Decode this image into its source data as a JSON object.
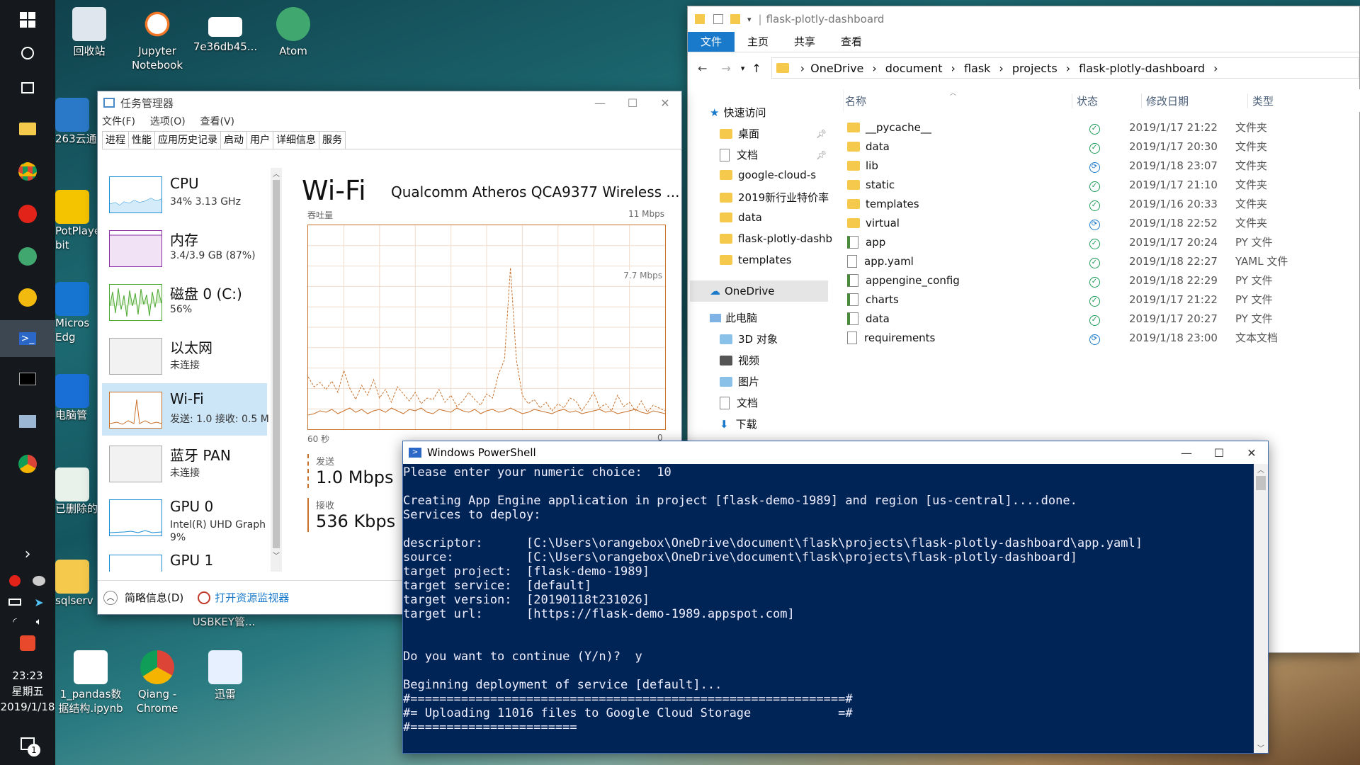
{
  "taskbar": {
    "time": "23:23",
    "weekday": "星期五",
    "date": "2019/1/18",
    "notification_count": "1"
  },
  "desktop": {
    "icons": [
      {
        "label": "回收站"
      },
      {
        "label": "Jupyter\nNotebook"
      },
      {
        "label": "7e36db45..."
      },
      {
        "label": "Atom"
      },
      {
        "label": "263云通"
      },
      {
        "label": "PotPlayer bit"
      },
      {
        "label": "Micros Edg"
      },
      {
        "label": "电脑管"
      },
      {
        "label": "已删除的"
      },
      {
        "label": "sqlserv"
      },
      {
        "label": "USBKEY管..."
      },
      {
        "label": "1_pandas数据结构.ipynb"
      },
      {
        "label": "Qiang - Chrome"
      },
      {
        "label": "迅雷"
      }
    ]
  },
  "task_manager": {
    "title": "任务管理器",
    "menu": [
      "文件(F)",
      "选项(O)",
      "查看(V)"
    ],
    "tabs": [
      "进程",
      "性能",
      "应用历史记录",
      "启动",
      "用户",
      "详细信息",
      "服务"
    ],
    "selected_tab": "性能",
    "sidebar": [
      {
        "name": "CPU",
        "sub": "34% 3.13 GHz"
      },
      {
        "name": "内存",
        "sub": "3.4/3.9 GB (87%)"
      },
      {
        "name": "磁盘 0 (C:)",
        "sub": "56%"
      },
      {
        "name": "以太网",
        "sub": "未连接"
      },
      {
        "name": "Wi-Fi",
        "sub": "发送: 1.0 接收: 0.5 M"
      },
      {
        "name": "蓝牙 PAN",
        "sub": "未连接"
      },
      {
        "name": "GPU 0",
        "sub": "Intel(R) UHD Graph",
        "sub2": "9%"
      },
      {
        "name": "GPU 1",
        "sub": ""
      }
    ],
    "panel": {
      "title": "Wi-Fi",
      "adapter": "Qualcomm Atheros QCA9377 Wireless ...",
      "throughput_label": "吞吐量",
      "max_label": "11 Mbps",
      "mid_label": "7.7 Mbps",
      "time_label": "60 秒",
      "zero_label": "0",
      "send_label": "发送",
      "send_value": "1.0 Mbps",
      "recv_label": "接收",
      "recv_value": "536 Kbps"
    },
    "footer": {
      "summary": "简略信息(D)",
      "monitor_link": "打开资源监视器"
    }
  },
  "explorer": {
    "title": "flask-plotly-dashboard",
    "ribbon": [
      "文件",
      "主页",
      "共享",
      "查看"
    ],
    "breadcrumb": [
      "OneDrive",
      "document",
      "flask",
      "projects",
      "flask-plotly-dashboard"
    ],
    "nav": [
      {
        "label": "快速访问"
      },
      {
        "label": "桌面"
      },
      {
        "label": "文档"
      },
      {
        "label": "google-cloud-s"
      },
      {
        "label": "2019新行业特价率"
      },
      {
        "label": "data"
      },
      {
        "label": "flask-plotly-dashb"
      },
      {
        "label": "templates"
      },
      {
        "label": "OneDrive"
      },
      {
        "label": "此电脑"
      },
      {
        "label": "3D 对象"
      },
      {
        "label": "视频"
      },
      {
        "label": "图片"
      },
      {
        "label": "文档"
      },
      {
        "label": "下载"
      }
    ],
    "columns": [
      "名称",
      "状态",
      "修改日期",
      "类型"
    ],
    "rows": [
      {
        "name": "__pycache__",
        "date": "2019/1/17 21:22",
        "type": "文件夹",
        "kind": "folder",
        "status": "synced"
      },
      {
        "name": "data",
        "date": "2019/1/17 20:30",
        "type": "文件夹",
        "kind": "folder",
        "status": "synced"
      },
      {
        "name": "lib",
        "date": "2019/1/18 23:07",
        "type": "文件夹",
        "kind": "folder",
        "status": "syncing"
      },
      {
        "name": "static",
        "date": "2019/1/17 21:10",
        "type": "文件夹",
        "kind": "folder",
        "status": "synced"
      },
      {
        "name": "templates",
        "date": "2019/1/16 20:33",
        "type": "文件夹",
        "kind": "folder",
        "status": "synced"
      },
      {
        "name": "virtual",
        "date": "2019/1/18 22:52",
        "type": "文件夹",
        "kind": "folder",
        "status": "syncing"
      },
      {
        "name": "app",
        "date": "2019/1/17 20:24",
        "type": "PY 文件",
        "kind": "py",
        "status": "synced"
      },
      {
        "name": "app.yaml",
        "date": "2019/1/18 22:27",
        "type": "YAML 文件",
        "kind": "file",
        "status": "synced"
      },
      {
        "name": "appengine_config",
        "date": "2019/1/18 22:29",
        "type": "PY 文件",
        "kind": "py",
        "status": "synced"
      },
      {
        "name": "charts",
        "date": "2019/1/17 21:22",
        "type": "PY 文件",
        "kind": "py",
        "status": "synced"
      },
      {
        "name": "data",
        "date": "2019/1/17 20:27",
        "type": "PY 文件",
        "kind": "py",
        "status": "synced"
      },
      {
        "name": "requirements",
        "date": "2019/1/18 23:00",
        "type": "文本文档",
        "kind": "file",
        "status": "syncing"
      }
    ]
  },
  "powershell": {
    "title": "Windows PowerShell",
    "lines": [
      "Please enter your numeric choice:  10",
      "",
      "Creating App Engine application in project [flask-demo-1989] and region [us-central]....done.",
      "Services to deploy:",
      "",
      "descriptor:      [C:\\Users\\orangebox\\OneDrive\\document\\flask\\projects\\flask-plotly-dashboard\\app.yaml]",
      "source:          [C:\\Users\\orangebox\\OneDrive\\document\\flask\\projects\\flask-plotly-dashboard]",
      "target project:  [flask-demo-1989]",
      "target service:  [default]",
      "target version:  [20190118t231026]",
      "target url:      [https://flask-demo-1989.appspot.com]",
      "",
      "",
      "Do you want to continue (Y/n)?  y",
      "",
      "Beginning deployment of service [default]...",
      "#============================================================#",
      "#= Uploading 11016 files to Google Cloud Storage            =#",
      "#======================="
    ]
  },
  "colors": {
    "wifi_orange": "#c8702a",
    "cpu_blue": "#1b8ed6",
    "mem_purple": "#8b2fa8",
    "disk_green": "#4da832",
    "ps_bg": "#012456",
    "sync_green": "#1a9b55",
    "sync_blue": "#1979ca"
  }
}
